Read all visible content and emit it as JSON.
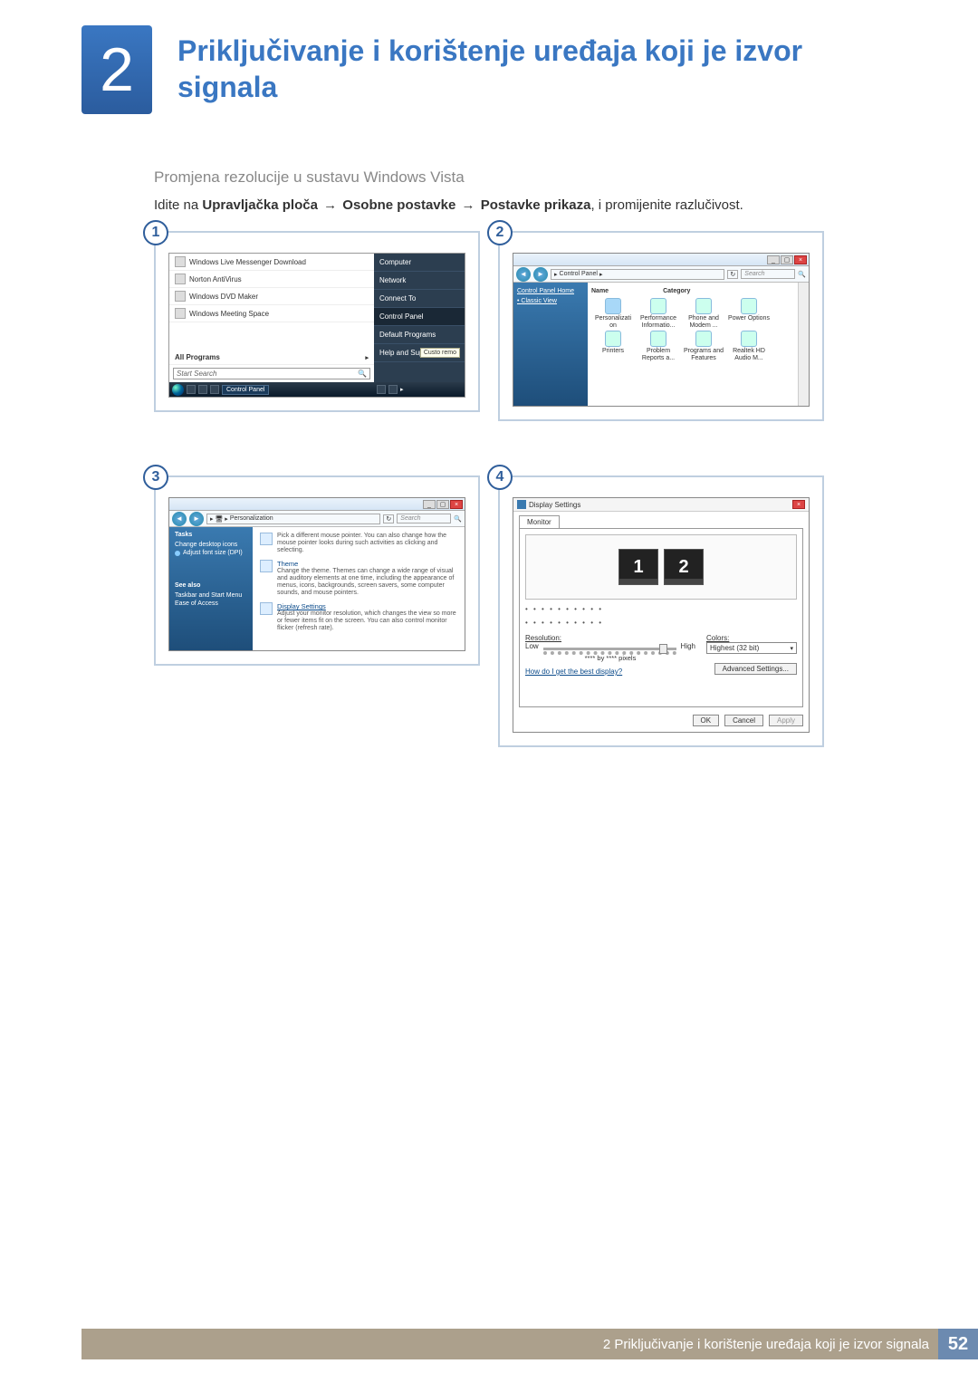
{
  "chapter": {
    "number": "2",
    "title": "Priključivanje i korištenje uređaja koji je izvor signala"
  },
  "subheading": "Promjena rezolucije u sustavu Windows Vista",
  "instruction": {
    "prefix": "Idite na ",
    "b1": "Upravljačka ploča",
    "b2": "Osobne postavke",
    "b3": "Postavke prikaza",
    "suffix": ", i promijenite razlučivost."
  },
  "steps": {
    "s1": "1",
    "s2": "2",
    "s3": "3",
    "s4": "4"
  },
  "startmenu": {
    "items": [
      "Windows Live Messenger Download",
      "Norton AntiVirus",
      "Windows DVD Maker",
      "Windows Meeting Space"
    ],
    "allprograms": "All Programs",
    "search": "Start Search",
    "right": [
      "Computer",
      "Network",
      "Connect To",
      "Control Panel",
      "Default Programs",
      "Help and Support"
    ],
    "tooltip": "Custo remo",
    "taskbar_active": "Control Panel"
  },
  "controlpanel": {
    "addr": "Control Panel",
    "search": "Search",
    "side_home": "Control Panel Home",
    "side_classic": "Classic View",
    "hdrs": {
      "name": "Name",
      "cat": "Category"
    },
    "icons": [
      "Personalizati on",
      "Performance Informatio...",
      "Phone and Modem ...",
      "Power Options",
      "Printers",
      "Problem Reports a...",
      "Programs and Features",
      "Realtek HD Audio M..."
    ]
  },
  "personalization": {
    "addr": "Personalization",
    "search": "Search",
    "side": {
      "tasks": "Tasks",
      "l1": "Change desktop icons",
      "l2": "Adjust font size (DPI)",
      "seealso": "See also",
      "l3": "Taskbar and Start Menu",
      "l4": "Ease of Access"
    },
    "items": [
      {
        "title": "",
        "desc": "Pick a different mouse pointer. You can also change how the mouse pointer looks during such activities as clicking and selecting."
      },
      {
        "title": "Theme",
        "desc": "Change the theme. Themes can change a wide range of visual and auditory elements at one time, including the appearance of menus, icons, backgrounds, screen savers, some computer sounds, and mouse pointers."
      },
      {
        "title": "Display Settings",
        "desc": "Adjust your monitor resolution, which changes the view so more or fewer items fit on the screen. You can also control monitor flicker (refresh rate)."
      }
    ]
  },
  "display": {
    "title": "Display Settings",
    "tab": "Monitor",
    "mon1": "1",
    "mon2": "2",
    "dots": "• • • • • • • • • •",
    "res_lbl": "Resolution:",
    "low": "Low",
    "high": "High",
    "col_lbl": "Colors:",
    "color_val": "Highest (32 bit)",
    "pixline": "**** by **** pixels",
    "help": "How do I get the best display?",
    "adv": "Advanced Settings...",
    "ok": "OK",
    "cancel": "Cancel",
    "apply": "Apply"
  },
  "footer": {
    "text": "2 Priključivanje i korištenje uređaja koji je izvor signala",
    "page": "52"
  }
}
